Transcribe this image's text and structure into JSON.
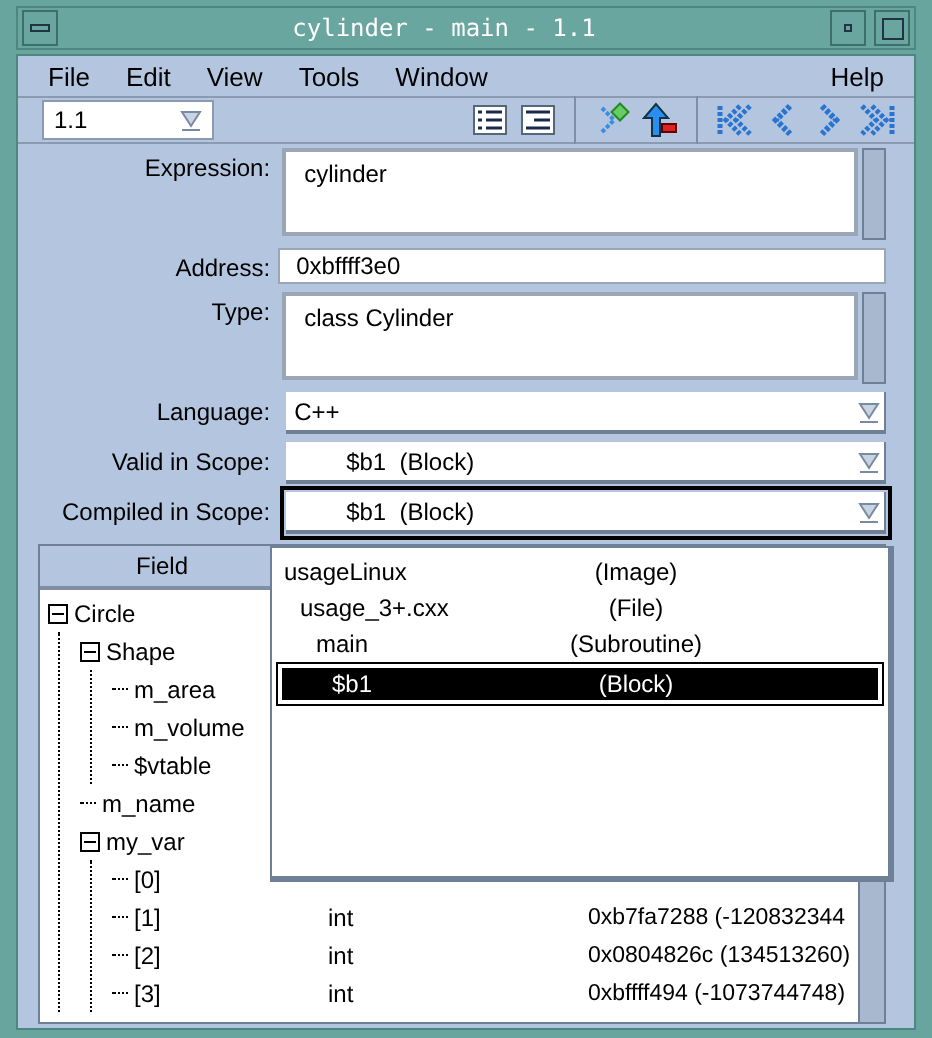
{
  "window": {
    "title": "cylinder - main - 1.1"
  },
  "menus": [
    "File",
    "Edit",
    "View",
    "Tools",
    "Window"
  ],
  "help_menu": "Help",
  "toolbar": {
    "frame": "1.1"
  },
  "form": {
    "expression": {
      "label": "Expression:",
      "value": "cylinder"
    },
    "address": {
      "label": "Address:",
      "value": "0xbffff3e0"
    },
    "type": {
      "label": "Type:",
      "value": "class Cylinder"
    },
    "language": {
      "label": "Language:",
      "value": "C++"
    },
    "valid_scope": {
      "label": "Valid in Scope:",
      "value": "$b1  (Block)"
    },
    "compiled_scope": {
      "label": "Compiled in Scope:",
      "value": "$b1  (Block)",
      "expanded": true
    }
  },
  "table": {
    "columns": [
      "Field"
    ],
    "rows": [
      {
        "field": "Circle",
        "expanded": true,
        "children": [
          {
            "field": "Shape",
            "expanded": true,
            "children": [
              {
                "field": "m_area"
              },
              {
                "field": "m_volume"
              },
              {
                "field": "$vtable"
              }
            ]
          },
          {
            "field": "m_name"
          },
          {
            "field": "my_var",
            "expanded": true,
            "children": [
              {
                "field": "[0]"
              },
              {
                "field": "[1]",
                "type": "int",
                "value": "0xb7fa7288 (-120832344"
              },
              {
                "field": "[2]",
                "type": "int",
                "value": "0x0804826c (134513260)"
              },
              {
                "field": "[3]",
                "type": "int",
                "value": "0xbffff494 (-1073744748)"
              }
            ]
          }
        ]
      }
    ]
  },
  "scope_list": [
    {
      "name": "usageLinux",
      "kind": "(Image)",
      "selected": false,
      "children": [
        {
          "name": "usage_3+.cxx",
          "kind": "(File)",
          "selected": false,
          "children": [
            {
              "name": "main",
              "kind": "(Subroutine)",
              "selected": false,
              "children": [
                {
                  "name": "$b1",
                  "kind": "(Block)",
                  "selected": true
                }
              ]
            }
          ]
        }
      ]
    }
  ]
}
